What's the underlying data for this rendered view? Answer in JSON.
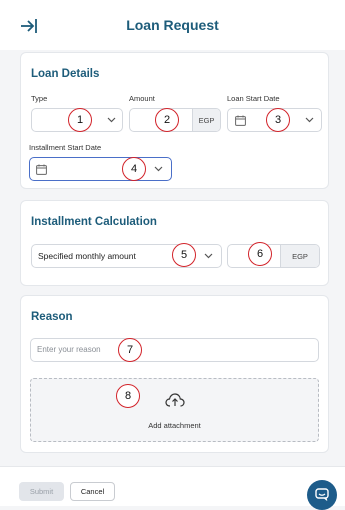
{
  "header": {
    "title": "Loan Request",
    "back_icon": "collapse-arrow-icon"
  },
  "loan_details": {
    "title": "Loan Details",
    "type": {
      "label": "Type",
      "value": "",
      "badge": "1"
    },
    "amount": {
      "label": "Amount",
      "value": "",
      "currency": "EGP",
      "badge": "2"
    },
    "loan_start_date": {
      "label": "Loan Start Date",
      "value": "",
      "badge": "3"
    },
    "installment_start_date": {
      "label": "Installment Start Date",
      "value": "",
      "badge": "4"
    }
  },
  "installment_calculation": {
    "title": "Installment Calculation",
    "method": {
      "value": "Specified monthly amount",
      "badge": "5"
    },
    "amount": {
      "value": "",
      "currency": "EGP",
      "badge": "6"
    }
  },
  "reason": {
    "title": "Reason",
    "input": {
      "placeholder": "Enter your reason",
      "badge": "7"
    },
    "attachment": {
      "label": "Add attachment",
      "badge": "8"
    }
  },
  "footer": {
    "submit_label": "Submit",
    "cancel_label": "Cancel"
  },
  "colors": {
    "accent": "#1d5c7a",
    "badge_border": "#d2232a",
    "focus": "#4a6fc8"
  }
}
